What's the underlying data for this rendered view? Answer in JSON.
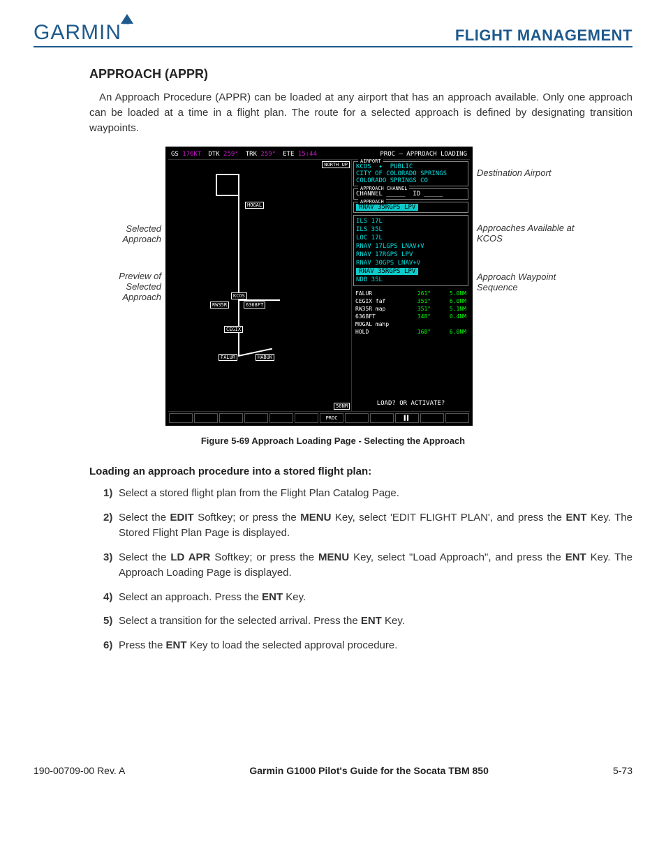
{
  "header": {
    "brand": "GARMIN",
    "section": "FLIGHT MANAGEMENT"
  },
  "title": "APPROACH (APPR)",
  "intro": "An Approach Procedure (APPR) can be loaded at any airport that has an approach available. Only one approach can be loaded at a time in a flight plan. The route for a selected approach is defined by designating transition waypoints.",
  "callouts_left": {
    "selected": "Selected Approach",
    "preview": "Preview of Selected Approach"
  },
  "callouts_right": {
    "dest": "Destination Airport",
    "avail": "Approaches Available at KCOS",
    "seq": "Approach Waypoint Sequence"
  },
  "mfd": {
    "top": {
      "gs_lbl": "GS",
      "gs_val": "176KT",
      "dtk_lbl": "DTK",
      "dtk_val": "259°",
      "trk_lbl": "TRK",
      "trk_val": "259°",
      "ete_lbl": "ETE",
      "ete_val": "15:44",
      "proc": "PROC – APPROACH LOADING"
    },
    "map": {
      "north": "NORTH UP",
      "pts": {
        "hogal": "HOGAL",
        "kcos": "KCOS",
        "rw35r": "RW35R",
        "alt": "6368FT",
        "cegix": "CEGIX",
        "falur": "FALUR",
        "habuk": "HABUK"
      },
      "scale": "50NM"
    },
    "airport": {
      "title": "AIRPORT",
      "code": "KCOS",
      "sym": "✦",
      "type": "PUBLIC",
      "name": "CITY OF COLORADO SPRINGS",
      "loc": "COLORADO SPRINGS CO"
    },
    "channel": {
      "title": "APPROACH CHANNEL",
      "chan": "CHANNEL _____",
      "id": "ID _____"
    },
    "approach": {
      "title": "APPROACH",
      "sel": "RNAV 35RGPS LPV"
    },
    "approaches": [
      "ILS 17L",
      "ILS 35L",
      "LOC 17L",
      "RNAV 17LGPS LNAV+V",
      "RNAV 17RGPS LPV",
      "RNAV 30GPS LNAV+V",
      "RNAV 35RGPS LPV",
      "NDB 35L"
    ],
    "waypoints": [
      {
        "n": "FALUR",
        "b": "261°",
        "d": "5.0NM"
      },
      {
        "n": "CEGIX faf",
        "b": "351°",
        "d": "6.0NM"
      },
      {
        "n": "RW35R map",
        "b": "351°",
        "d": "5.1NM"
      },
      {
        "n": "6368FT",
        "b": "348°",
        "d": "0.4NM"
      },
      {
        "n": "MOGAL mahp",
        "b": "",
        "d": ""
      },
      {
        "n": "HOLD",
        "b": "168°",
        "d": "6.0NM"
      }
    ],
    "prompt": "LOAD?  OR  ACTIVATE?",
    "softkey": "PROC"
  },
  "caption": "Figure 5-69  Approach Loading Page - Selecting the Approach",
  "subhead": "Loading an approach procedure into a stored flight plan:",
  "steps": [
    {
      "n": "1)",
      "t": "Select a stored flight plan from the Flight Plan Catalog Page."
    },
    {
      "n": "2)",
      "t": "Select the <b>EDIT</b> Softkey; or press the <b>MENU</b> Key, select 'EDIT FLIGHT PLAN', and press the <b>ENT</b> Key.  The Stored Flight Plan Page is displayed."
    },
    {
      "n": "3)",
      "t": "Select the <b>LD APR</b> Softkey; or press the <b>MENU</b> Key, select \"Load Approach\", and press the <b>ENT</b> Key.  The Approach Loading Page is displayed."
    },
    {
      "n": "4)",
      "t": "Select an approach.  Press the <b>ENT</b> Key."
    },
    {
      "n": "5)",
      "t": "Select a transition for the selected arrival.  Press the <b>ENT</b> Key."
    },
    {
      "n": "6)",
      "t": "Press the <b>ENT</b> Key to load the selected approval procedure."
    }
  ],
  "footer": {
    "left": "190-00709-00  Rev. A",
    "mid": "Garmin G1000 Pilot's Guide for the Socata TBM 850",
    "right": "5-73"
  }
}
